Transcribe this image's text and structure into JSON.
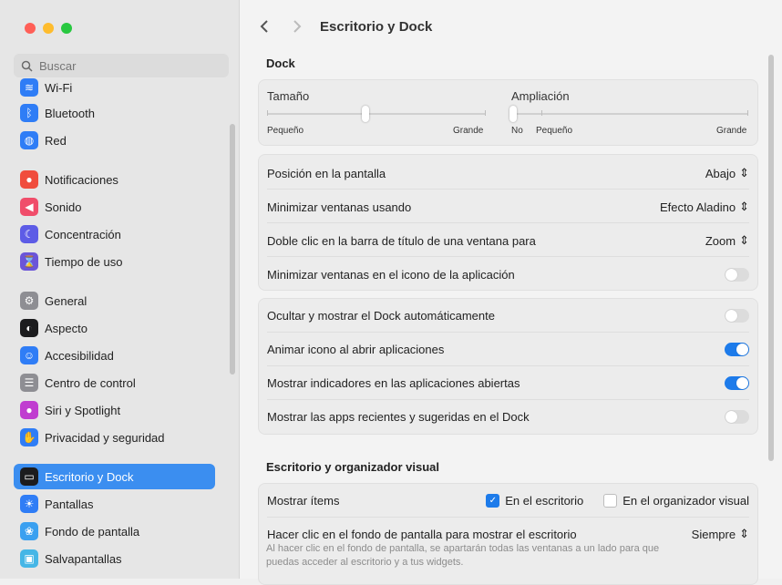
{
  "window": {
    "title": "Escritorio y Dock"
  },
  "search": {
    "placeholder": "Buscar"
  },
  "sidebar": {
    "items": [
      {
        "label": "Wi-Fi",
        "icon": "wifi-icon",
        "color": "#2f7df6"
      },
      {
        "label": "Bluetooth",
        "icon": "bluetooth-icon",
        "color": "#2f7df6"
      },
      {
        "label": "Red",
        "icon": "globe-icon",
        "color": "#2f7df6"
      },
      {
        "label": "Notificaciones",
        "icon": "bell-icon",
        "color": "#f04d3d"
      },
      {
        "label": "Sonido",
        "icon": "speaker-icon",
        "color": "#f04d6a"
      },
      {
        "label": "Concentración",
        "icon": "moon-icon",
        "color": "#5d5ce6"
      },
      {
        "label": "Tiempo de uso",
        "icon": "hourglass-icon",
        "color": "#6b55d8"
      },
      {
        "label": "General",
        "icon": "gear-icon",
        "color": "#8e8e93"
      },
      {
        "label": "Aspecto",
        "icon": "appearance-icon",
        "color": "#1c1c1e"
      },
      {
        "label": "Accesibilidad",
        "icon": "accessibility-icon",
        "color": "#2f7df6"
      },
      {
        "label": "Centro de control",
        "icon": "control-center-icon",
        "color": "#8e8e93"
      },
      {
        "label": "Siri y Spotlight",
        "icon": "siri-icon",
        "color": "#c03dd0"
      },
      {
        "label": "Privacidad y seguridad",
        "icon": "hand-icon",
        "color": "#2f7df6"
      },
      {
        "label": "Escritorio y Dock",
        "icon": "dock-icon",
        "color": "#1c1c1e"
      },
      {
        "label": "Pantallas",
        "icon": "sun-icon",
        "color": "#2f7df6"
      },
      {
        "label": "Fondo de pantalla",
        "icon": "wallpaper-icon",
        "color": "#3aa0f0"
      },
      {
        "label": "Salvapantallas",
        "icon": "screensaver-icon",
        "color": "#45b6e6"
      }
    ]
  },
  "main": {
    "title": "Escritorio y Dock",
    "dock_section": "Dock",
    "size": {
      "label": "Tamaño",
      "min": "Pequeño",
      "max": "Grande",
      "value": 0.45
    },
    "magnification": {
      "label": "Ampliación",
      "off": "No",
      "min": "Pequeño",
      "max": "Grande",
      "value": 0
    },
    "rows1": [
      {
        "label": "Posición en la pantalla",
        "value": "Abajo"
      },
      {
        "label": "Minimizar ventanas usando",
        "value": "Efecto Aladino"
      },
      {
        "label": "Doble clic en la barra de título de una ventana para",
        "value": "Zoom"
      },
      {
        "label": "Minimizar ventanas en el icono de la aplicación",
        "toggle": false
      }
    ],
    "rows2": [
      {
        "label": "Ocultar y mostrar el Dock automáticamente",
        "toggle": false
      },
      {
        "label": "Animar icono al abrir aplicaciones",
        "toggle": true
      },
      {
        "label": "Mostrar indicadores en las aplicaciones abiertas",
        "toggle": true
      },
      {
        "label": "Mostrar las apps recientes y sugeridas en el Dock",
        "toggle": false
      }
    ],
    "desktop_section": "Escritorio y organizador visual",
    "show_items": {
      "label": "Mostrar ítems",
      "opt1": "En el escritorio",
      "opt1_checked": true,
      "opt2": "En el organizador visual",
      "opt2_checked": false
    },
    "click_wallpaper": {
      "label": "Hacer clic en el fondo de pantalla para mostrar el escritorio",
      "value": "Siempre",
      "desc": "Al hacer clic en el fondo de pantalla, se apartarán todas las ventanas a un lado para que puedas acceder al escritorio y a tus widgets."
    }
  }
}
